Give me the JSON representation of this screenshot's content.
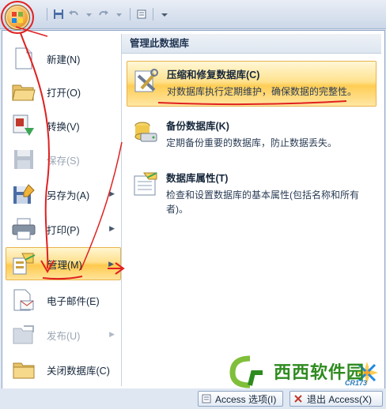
{
  "left_menu": {
    "items": [
      {
        "label": "新建(N)",
        "icon": "new-document-icon",
        "disabled": false,
        "has_submenu": false
      },
      {
        "label": "打开(O)",
        "icon": "open-folder-icon",
        "disabled": false,
        "has_submenu": false
      },
      {
        "label": "转换(V)",
        "icon": "convert-icon",
        "disabled": false,
        "has_submenu": false
      },
      {
        "label": "保存(S)",
        "icon": "save-disk-icon",
        "disabled": true,
        "has_submenu": false
      },
      {
        "label": "另存为(A)",
        "icon": "save-as-icon",
        "disabled": false,
        "has_submenu": true
      },
      {
        "label": "打印(P)",
        "icon": "printer-icon",
        "disabled": false,
        "has_submenu": true
      },
      {
        "label": "管理(M)",
        "icon": "manage-database-icon",
        "disabled": false,
        "has_submenu": true,
        "active": true
      },
      {
        "label": "电子邮件(E)",
        "icon": "email-icon",
        "disabled": false,
        "has_submenu": false
      },
      {
        "label": "发布(U)",
        "icon": "publish-icon",
        "disabled": true,
        "has_submenu": true
      },
      {
        "label": "关闭数据库(C)",
        "icon": "close-database-icon",
        "disabled": false,
        "has_submenu": false
      }
    ]
  },
  "right_pane": {
    "title": "管理此数据库",
    "items": [
      {
        "title": "压缩和修复数据库(C)",
        "desc": "对数据库执行定期维护，确保数据的完整性。",
        "icon": "compact-repair-icon",
        "active": true
      },
      {
        "title": "备份数据库(K)",
        "desc": "定期备份重要的数据库，防止数据丢失。",
        "icon": "backup-database-icon",
        "active": false
      },
      {
        "title": "数据库属性(T)",
        "desc": "检查和设置数据库的基本属性(包括名称和所有者)。",
        "icon": "database-properties-icon",
        "active": false
      }
    ]
  },
  "bottom": {
    "options_label": "Access 选项(I)",
    "exit_label": "退出 Access(X)"
  },
  "watermark": {
    "text": "西西软件园",
    "sub": "CR173"
  },
  "colors": {
    "highlight": "#ffe08c",
    "annotation_red": "#e02020"
  }
}
